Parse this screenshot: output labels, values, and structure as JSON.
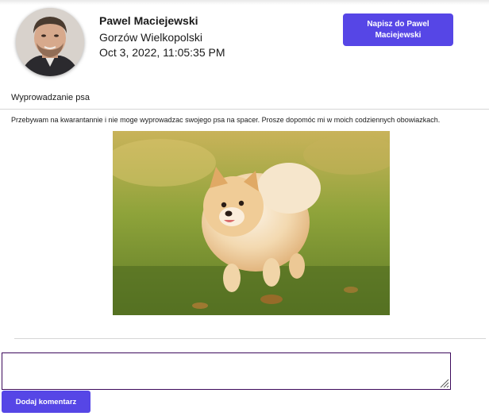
{
  "profile": {
    "name": "Pawel Maciejewski",
    "city": "Gorzów Wielkopolski",
    "date": "Oct 3, 2022, 11:05:35 PM",
    "message_button_label": "Napisz do Pawel Maciejewski"
  },
  "post": {
    "title": "Wyprowadzanie psa",
    "description": "Przebywam na kwarantannie i nie moge wyprowadzac swojego psa na spacer. Prosze dopomóc mi w moich codziennych obowiazkach."
  },
  "comment": {
    "value": "",
    "submit_label": "Dodaj komentarz"
  },
  "colors": {
    "accent": "#5646e6",
    "comment_border": "#3d0a5c"
  }
}
